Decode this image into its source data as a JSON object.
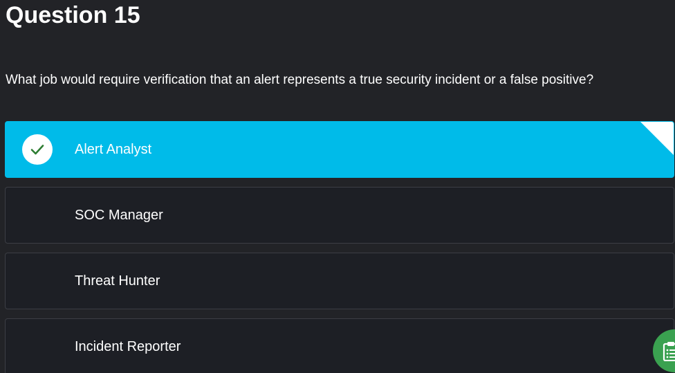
{
  "quiz": {
    "title": "Question 15",
    "question": "What job would require verification that an alert represents a true security incident or a false positive?",
    "options": [
      {
        "label": "Alert Analyst",
        "selected": true
      },
      {
        "label": "SOC Manager",
        "selected": false
      },
      {
        "label": "Threat Hunter",
        "selected": false
      },
      {
        "label": "Incident Reporter",
        "selected": false
      }
    ]
  },
  "icons": {
    "check": "checkmark-icon",
    "fab": "clipboard-icon"
  },
  "colors": {
    "background": "#222327",
    "selected": "#00bbe9",
    "option": "#1d1f25",
    "check": "#2e7d32",
    "fab": "#3aa150"
  }
}
